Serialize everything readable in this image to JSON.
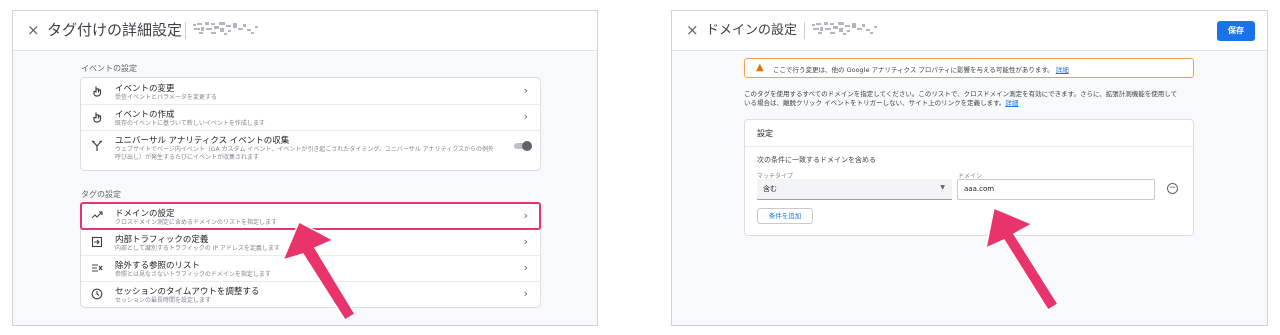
{
  "left_panel": {
    "title": "タグ付けの詳細設定",
    "close_glyph": "×",
    "events_section_label": "イベントの設定",
    "event_rows": [
      {
        "icon": "touch-icon",
        "title": "イベントの変更",
        "subtitle": "受信イベントとパラメータを変更する"
      },
      {
        "icon": "touch-icon",
        "title": "イベントの作成",
        "subtitle": "既存のイベントに基づいて新しいイベントを作成します"
      },
      {
        "icon": "fork-icon",
        "title": "ユニバーサル アナリティクス イベントの収集",
        "subtitle": "ウェブサイトでページ内イベント（GA カスタム イベント、イベントが引き起こされたタイミング、ユニバーサル アナリティクスからの例外",
        "subtitle2": "呼び出し）が発生するたびにイベントが収集されます",
        "toggle": "off"
      }
    ],
    "tag_section_label": "タグの設定",
    "tag_rows": [
      {
        "icon": "domain-icon",
        "title": "ドメインの設定",
        "subtitle": "クロスドメイン測定に含めるドメインのリストを指定します",
        "highlighted": true
      },
      {
        "icon": "login-icon",
        "title": "内部トラフィックの定義",
        "subtitle": "内部として識別するトラフィックの IP アドレスを定義します"
      },
      {
        "icon": "filter-icon",
        "title": "除外する参照のリスト",
        "subtitle": "参照とは見なさないトラフィックのドメインを指定します"
      },
      {
        "icon": "clock-icon",
        "title": "セッションのタイムアウトを調整する",
        "subtitle": "セッションの最長時間を設定します"
      }
    ],
    "chevron_glyph": "›",
    "highlight_color": "#e8336b"
  },
  "right_panel": {
    "title": "ドメインの設定",
    "close_glyph": "×",
    "save_label": "保存",
    "warning_glyph": "▲",
    "warning_text": "ここで行う変更は、他の Google アナリティクス プロパティに影響を与える可能性があります。",
    "warning_link": "詳細",
    "description_line1": "このタグを使用するすべてのドメインを指定してください。このリストで、クロスドメイン測定を有効にできます。さらに、拡張計測機能を使用して",
    "description_line2": "いる場合は、離脱クリック イベントをトリガーしない、サイト上のリンクを定義します。",
    "description_link": "詳細",
    "settings_title": "設定",
    "condition_label": "次の条件に一致するドメインを含める",
    "match_type_label": "マッチタイプ",
    "match_type_value": "含む",
    "domain_label": "ドメイン",
    "domain_value": "aaa.com",
    "add_condition_label": "条件を追加",
    "remove_glyph": "−",
    "accent_color": "#1a73e8",
    "arrow_color": "#e8336b"
  }
}
